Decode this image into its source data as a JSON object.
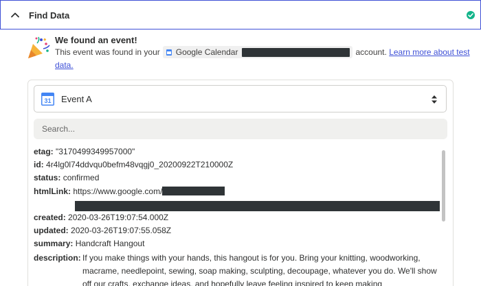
{
  "header": {
    "title": "Find Data"
  },
  "found": {
    "title": "We found an event!",
    "prefix": "This event was found in your",
    "app_name": "Google Calendar",
    "suffix": "account.",
    "link_part1": "Learn more about test",
    "link_part2": "data."
  },
  "selector": {
    "value": "Event A",
    "calendar_day": "31"
  },
  "search": {
    "placeholder": "Search..."
  },
  "fields": {
    "etag_key": "etag:",
    "etag_val": "\"3170499349957000\"",
    "id_key": "id:",
    "id_val": "4r4lg0l74ddvqu0befm48vqgj0_20200922T210000Z",
    "status_key": "status:",
    "status_val": "confirmed",
    "htmllink_key": "htmlLink:",
    "htmllink_val": "https://www.google.com/",
    "created_key": "created:",
    "created_val": "2020-03-26T19:07:54.000Z",
    "updated_key": "updated:",
    "updated_val": "2020-03-26T19:07:55.058Z",
    "summary_key": "summary:",
    "summary_val": "Handcraft Hangout",
    "description_key": "description:",
    "description_val": "If you make things with your hands, this hangout is for you. Bring your knitting, woodworking, macrame, needlepoint, sewing, soap making, sculpting, decoupage, whatever you do. We'll show off our crafts, exchange ideas, and hopefully leave feeling inspired to keep making"
  },
  "colors": {
    "accent": "#3d4fd6",
    "success": "#13b48a",
    "redaction": "#2f3437"
  }
}
